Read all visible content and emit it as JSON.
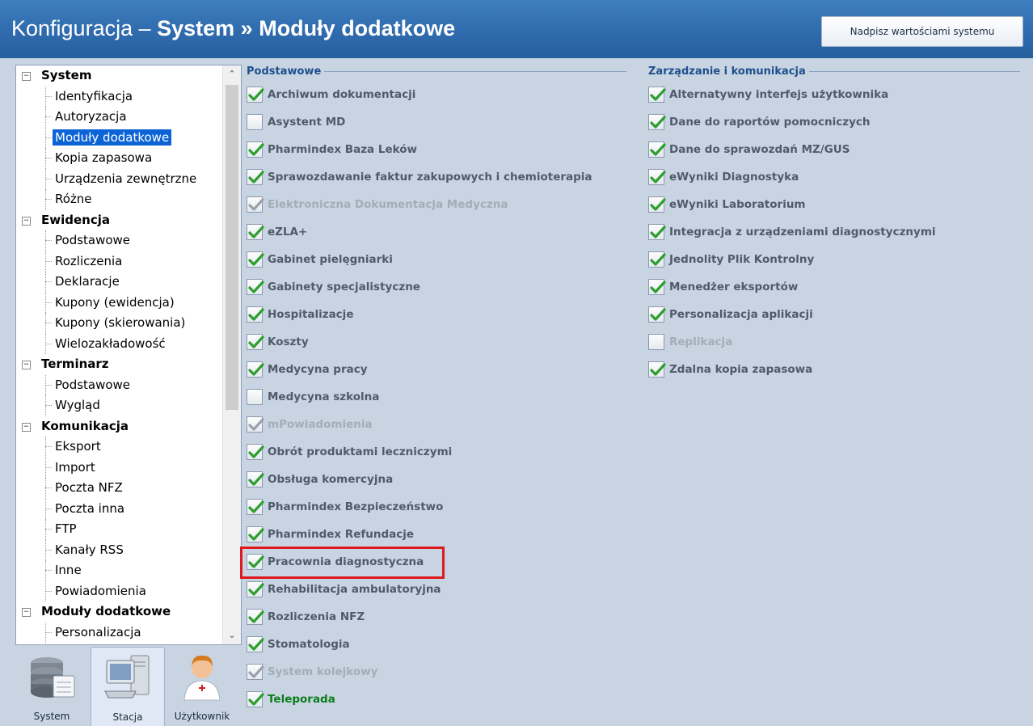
{
  "header": {
    "title_prefix": "Konfiguracja – ",
    "title_bold": "System » Moduły dodatkowe",
    "override_button": "Nadpisz wartościami systemu"
  },
  "tree": [
    {
      "label": "System",
      "children": [
        "Identyfikacja",
        "Autoryzacja",
        "Moduły dodatkowe",
        "Kopia zapasowa",
        "Urządzenia zewnętrzne",
        "Różne"
      ]
    },
    {
      "label": "Ewidencja",
      "children": [
        "Podstawowe",
        "Rozliczenia",
        "Deklaracje",
        "Kupony (ewidencja)",
        "Kupony (skierowania)",
        "Wielozakładowość"
      ]
    },
    {
      "label": "Terminarz",
      "children": [
        "Podstawowe",
        "Wygląd"
      ]
    },
    {
      "label": "Komunikacja",
      "children": [
        "Eksport",
        "Import",
        "Poczta NFZ",
        "Poczta inna",
        "FTP",
        "Kanały RSS",
        "Inne",
        "Powiadomienia"
      ]
    },
    {
      "label": "Moduły dodatkowe",
      "children": [
        "Personalizacja"
      ]
    }
  ],
  "tree_selected": "Moduły dodatkowe",
  "bottom_tabs": [
    {
      "label": "System",
      "icon": "database-icon",
      "active": false
    },
    {
      "label": "Stacja",
      "icon": "workstation-icon",
      "active": true
    },
    {
      "label": "Użytkownik",
      "icon": "user-doctor-icon",
      "active": false
    }
  ],
  "sections": [
    {
      "title": "Podstawowe",
      "items": [
        {
          "label": "Archiwum dokumentacji",
          "checked": true,
          "enabled": true
        },
        {
          "label": "Asystent MD",
          "checked": false,
          "enabled": true
        },
        {
          "label": "Pharmindex Baza Leków",
          "checked": true,
          "enabled": true
        },
        {
          "label": "Sprawozdawanie faktur zakupowych i chemioterapia",
          "checked": true,
          "enabled": true
        },
        {
          "label": "Elektroniczna Dokumentacja Medyczna",
          "checked": true,
          "enabled": false
        },
        {
          "label": "eZLA+",
          "checked": true,
          "enabled": true
        },
        {
          "label": "Gabinet pielęgniarki",
          "checked": true,
          "enabled": true
        },
        {
          "label": "Gabinety specjalistyczne",
          "checked": true,
          "enabled": true
        },
        {
          "label": "Hospitalizacje",
          "checked": true,
          "enabled": true
        },
        {
          "label": "Koszty",
          "checked": true,
          "enabled": true
        },
        {
          "label": "Medycyna pracy",
          "checked": true,
          "enabled": true
        },
        {
          "label": "Medycyna szkolna",
          "checked": false,
          "enabled": true
        },
        {
          "label": "mPowiadomienia",
          "checked": true,
          "enabled": false
        },
        {
          "label": "Obrót produktami leczniczymi",
          "checked": true,
          "enabled": true
        },
        {
          "label": "Obsługa komercyjna",
          "checked": true,
          "enabled": true
        },
        {
          "label": "Pharmindex Bezpieczeństwo",
          "checked": true,
          "enabled": true
        },
        {
          "label": "Pharmindex Refundacje",
          "checked": true,
          "enabled": true
        },
        {
          "label": "Pracownia diagnostyczna",
          "checked": true,
          "enabled": true
        },
        {
          "label": "Rehabilitacja ambulatoryjna",
          "checked": true,
          "enabled": true
        },
        {
          "label": "Rozliczenia NFZ",
          "checked": true,
          "enabled": true
        },
        {
          "label": "Stomatologia",
          "checked": true,
          "enabled": true
        },
        {
          "label": "System kolejkowy",
          "checked": true,
          "enabled": false
        },
        {
          "label": "Teleporada",
          "checked": true,
          "enabled": true,
          "highlight": true
        }
      ]
    },
    {
      "title": "Zarządzanie i komunikacja",
      "items": [
        {
          "label": "Alternatywny interfejs użytkownika",
          "checked": true,
          "enabled": true
        },
        {
          "label": "Dane do raportów pomocniczych",
          "checked": true,
          "enabled": true
        },
        {
          "label": "Dane do sprawozdań MZ/GUS",
          "checked": true,
          "enabled": true
        },
        {
          "label": "eWyniki Diagnostyka",
          "checked": true,
          "enabled": true
        },
        {
          "label": "eWyniki Laboratorium",
          "checked": true,
          "enabled": true
        },
        {
          "label": "Integracja z urządzeniami diagnostycznymi",
          "checked": true,
          "enabled": true
        },
        {
          "label": "Jednolity Plik Kontrolny",
          "checked": true,
          "enabled": true
        },
        {
          "label": "Menedżer eksportów",
          "checked": true,
          "enabled": true
        },
        {
          "label": "Personalizacja aplikacji",
          "checked": true,
          "enabled": true
        },
        {
          "label": "Replikacja",
          "checked": false,
          "enabled": false
        },
        {
          "label": "Zdalna kopia zapasowa",
          "checked": true,
          "enabled": true
        }
      ]
    }
  ],
  "colors": {
    "title_bar": "#2f6bad",
    "check_green": "#2e9e2e",
    "check_disabled": "#9aa1aa",
    "selection": "#0c63d6",
    "highlight_border": "#e0191e",
    "section_header": "#1d4f8c"
  }
}
